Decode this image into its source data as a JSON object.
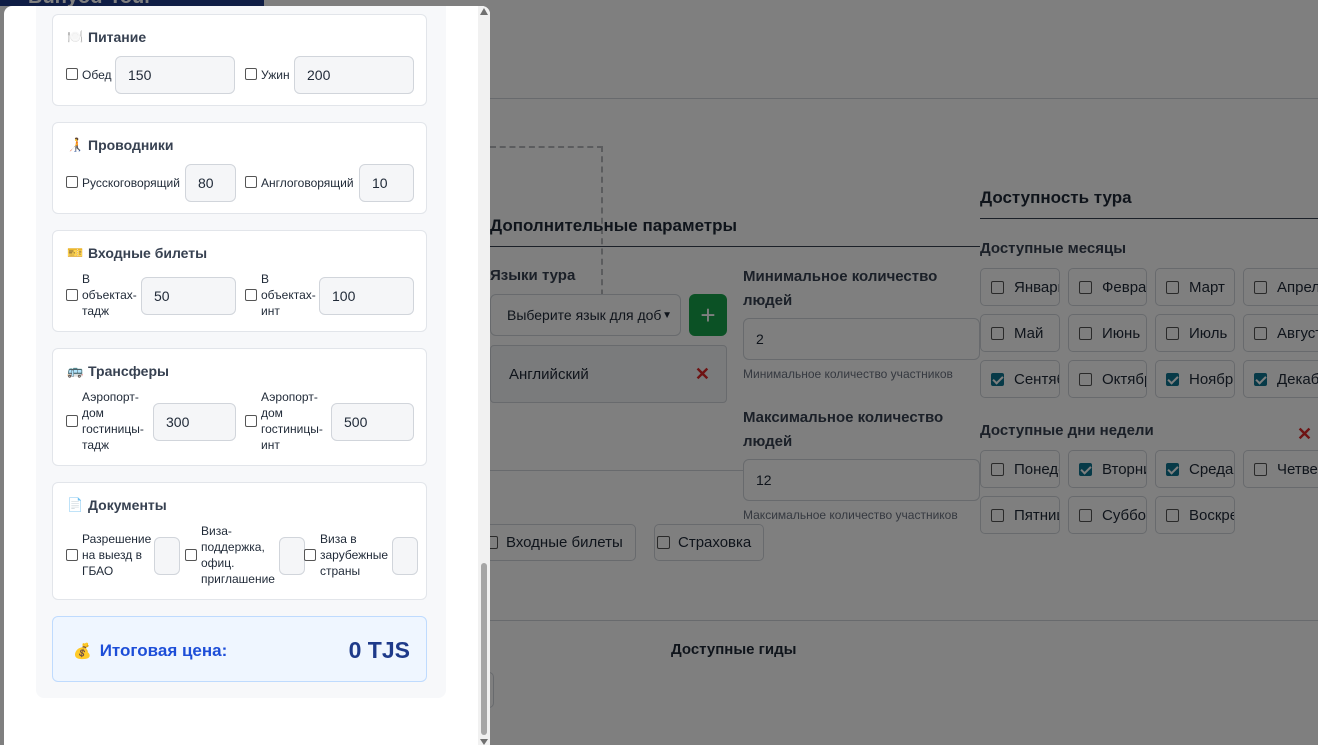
{
  "background": {
    "brand": "Bunyod-Tour",
    "additional_params_title": "Дополнительные параметры",
    "languages": {
      "title": "Языки тура",
      "select_placeholder": "Выберите язык для доб",
      "add_label": "+",
      "selected": [
        {
          "name": "Английский",
          "remove": "✕"
        }
      ]
    },
    "min_people": {
      "label": "Минимальное количество людей",
      "value": "2",
      "hint": "Минимальное количество участников"
    },
    "max_people": {
      "label": "Максимальное количество людей",
      "value": "12",
      "hint": "Максимальное количество участников"
    },
    "options": [
      "Входные билеты",
      "Страховка"
    ],
    "availability": {
      "title": "Доступность тура",
      "months_title": "Доступные месяцы",
      "months": [
        {
          "label": "Январь",
          "checked": false
        },
        {
          "label": "Февраль",
          "checked": false
        },
        {
          "label": "Март",
          "checked": false
        },
        {
          "label": "Апрель",
          "checked": false
        },
        {
          "label": "Май",
          "checked": false
        },
        {
          "label": "Июнь",
          "checked": false
        },
        {
          "label": "Июль",
          "checked": false
        },
        {
          "label": "Август",
          "checked": false
        },
        {
          "label": "Сентябрь",
          "checked": true
        },
        {
          "label": "Октябрь",
          "checked": false
        },
        {
          "label": "Ноябрь",
          "checked": true
        },
        {
          "label": "Декабрь",
          "checked": true
        }
      ],
      "days_title": "Доступные дни недели",
      "days_close": "✕",
      "days": [
        {
          "label": "Понедельник",
          "checked": false
        },
        {
          "label": "Вторник",
          "checked": true
        },
        {
          "label": "Среда",
          "checked": true
        },
        {
          "label": "Четверг",
          "checked": false
        },
        {
          "label": "Пятница",
          "checked": false
        },
        {
          "label": "Суббота",
          "checked": false
        },
        {
          "label": "Воскресенье",
          "checked": false
        }
      ]
    },
    "guides_title": "Доступные гиды"
  },
  "modal": {
    "food": {
      "icon": "🍽️",
      "title": "Питание",
      "items": [
        {
          "label": "Обед",
          "price": "150"
        },
        {
          "label": "Ужин",
          "price": "200"
        }
      ]
    },
    "guides": {
      "icon": "🧑‍🦯",
      "title": "Проводники",
      "items": [
        {
          "label": "Русскоговорящий",
          "price": "80"
        },
        {
          "label": "Англоговорящий",
          "price": "10"
        }
      ]
    },
    "tickets": {
      "icon": "🎫",
      "title": "Входные билеты",
      "items": [
        {
          "label_lines": [
            "В",
            "объектах-",
            "тадж"
          ],
          "price": "50"
        },
        {
          "label_lines": [
            "В",
            "объектах-",
            "инт"
          ],
          "price": "100"
        }
      ]
    },
    "transfers": {
      "icon": "🚌",
      "title": "Трансферы",
      "items": [
        {
          "label_lines": [
            "Аэропорт-",
            "дом",
            "гостиницы-",
            "тадж"
          ],
          "price": "300"
        },
        {
          "label_lines": [
            "Аэропорт-",
            "дом",
            "гостиницы-",
            "инт"
          ],
          "price": "500"
        }
      ]
    },
    "documents": {
      "icon": "📄",
      "title": "Документы",
      "items": [
        {
          "label_lines": [
            "Разрешение",
            "на выезд в",
            "ГБАО"
          ],
          "price": ""
        },
        {
          "label_lines": [
            "Виза-",
            "поддержка,",
            "офиц.",
            "приглашение"
          ],
          "price": ""
        },
        {
          "label_lines": [
            "Виза в",
            "зарубежные",
            "страны"
          ],
          "price": ""
        }
      ]
    },
    "total": {
      "icon": "💰",
      "label": "Итоговая цена:",
      "value": "0 TJS"
    }
  },
  "colors": {
    "accent": "#1d4ed8",
    "add_button": "#16a34a",
    "remove": "#dc2626",
    "check": "#0e7490"
  }
}
